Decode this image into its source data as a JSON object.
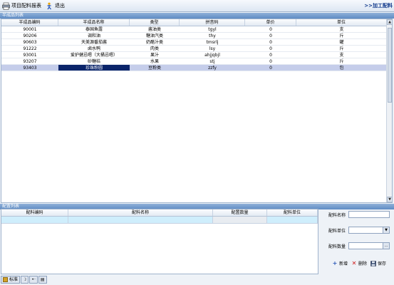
{
  "toolbar": {
    "report_label": "项目配料报表",
    "exit_label": "退出",
    "right_link": ">>加工配料"
  },
  "section1": {
    "title": "半成品列表"
  },
  "grid1": {
    "columns": [
      "半成品编码",
      "半成品名称",
      "类型",
      "拼音码",
      "单价",
      "单位"
    ],
    "rows": [
      [
        "90001",
        "泰国鱼露",
        "酱油类",
        "tgyl",
        "0",
        "支"
      ],
      [
        "90206",
        "调和油",
        "糖油汽类",
        "thy",
        "0",
        "斤"
      ],
      [
        "90603",
        "天美源番茄酱",
        "奶酪汁类",
        "tmsrlj",
        "0",
        "罐"
      ],
      [
        "91222",
        "卤水鸭",
        "肉类",
        "lsy",
        "0",
        "斤"
      ],
      [
        "93001",
        "爱护健忌嗯（大桶忌嗯）",
        "果汁",
        "ahjjqbjl",
        "0",
        "支"
      ],
      [
        "93207",
        "砂糖桔",
        "水果",
        "stj",
        "0",
        "斤"
      ],
      [
        "93403",
        "珍珠粉圆",
        "豆粉类",
        "zzfy",
        "0",
        "包"
      ]
    ],
    "selected_row": 6
  },
  "section2": {
    "title": "配置列表"
  },
  "grid2": {
    "columns": [
      "配料编码",
      "配料名称",
      "配置数量",
      "配料单位"
    ]
  },
  "form": {
    "name_label": "配料名称",
    "name_value": "",
    "unit_label": "配料单位",
    "unit_value": "",
    "qty_label": "配料数量",
    "qty_value": ""
  },
  "actions": {
    "add_label": "新增",
    "delete_label": "删除",
    "save_label": "保存"
  },
  "status": {
    "ime_label": "标准"
  },
  "icons": {
    "report": "printer-icon",
    "exit": "exit-icon",
    "add": "plus-icon",
    "delete": "x-icon",
    "save": "floppy-icon"
  },
  "colors": {
    "header_bar": "#6f98cc",
    "selected_cell": "#0a246a",
    "selected_row": "#c5cdea",
    "link": "#123a8c"
  }
}
